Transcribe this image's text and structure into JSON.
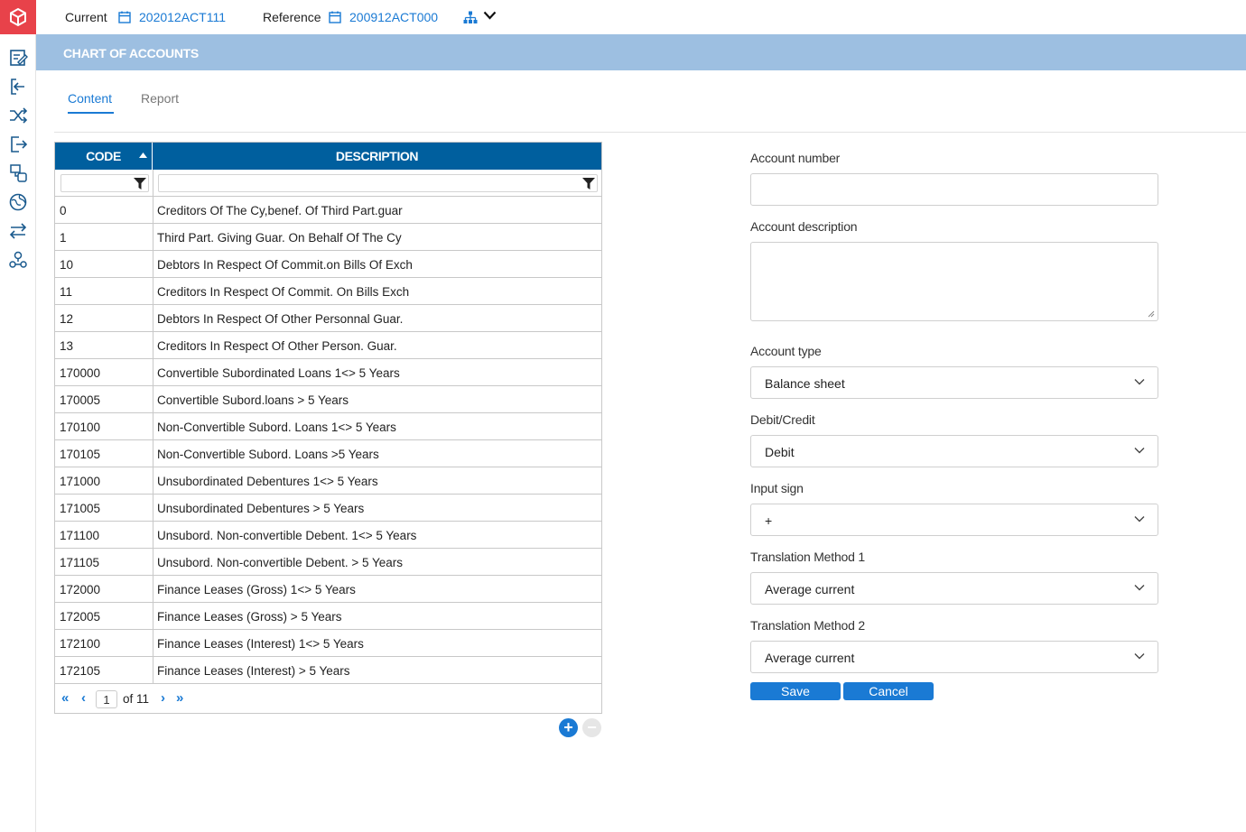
{
  "topbar": {
    "current_label": "Current",
    "current_value": "202012ACT111",
    "reference_label": "Reference",
    "reference_value": "200912ACT000"
  },
  "section": {
    "title": "CHART OF ACCOUNTS"
  },
  "tabs": [
    {
      "label": "Content",
      "active": true
    },
    {
      "label": "Report",
      "active": false
    }
  ],
  "sidebar": {
    "icons": [
      "edit-sheet-icon",
      "import-icon",
      "shuffle-icon",
      "export-icon",
      "copy-database-icon",
      "globe-icon",
      "transfer-icon",
      "network-user-icon"
    ]
  },
  "grid": {
    "columns": [
      "CODE",
      "DESCRIPTION"
    ],
    "rows": [
      {
        "code": "0",
        "description": "Creditors Of The Cy,benef. Of Third Part.guar"
      },
      {
        "code": "1",
        "description": "Third Part. Giving Guar. On Behalf Of The Cy"
      },
      {
        "code": "10",
        "description": "Debtors In Respect Of Commit.on Bills Of Exch"
      },
      {
        "code": "11",
        "description": "Creditors In Respect Of Commit. On Bills Exch"
      },
      {
        "code": "12",
        "description": "Debtors In Respect Of Other Personnal Guar."
      },
      {
        "code": "13",
        "description": "Creditors In Respect Of Other Person. Guar."
      },
      {
        "code": "170000",
        "description": "Convertible Subordinated Loans 1<> 5 Years"
      },
      {
        "code": "170005",
        "description": "Convertible Subord.loans > 5 Years"
      },
      {
        "code": "170100",
        "description": "Non-Convertible Subord. Loans 1<> 5 Years"
      },
      {
        "code": "170105",
        "description": "Non-Convertible Subord. Loans >5 Years"
      },
      {
        "code": "171000",
        "description": "Unsubordinated Debentures 1<> 5 Years"
      },
      {
        "code": "171005",
        "description": "Unsubordinated Debentures > 5 Years"
      },
      {
        "code": "171100",
        "description": "Unsubord. Non-convertible Debent. 1<> 5 Years"
      },
      {
        "code": "171105",
        "description": "Unsubord. Non-convertible Debent. > 5 Years"
      },
      {
        "code": "172000",
        "description": "Finance Leases (Gross) 1<> 5 Years"
      },
      {
        "code": "172005",
        "description": "Finance Leases (Gross) > 5 Years"
      },
      {
        "code": "172100",
        "description": "Finance Leases (Interest) 1<> 5 Years"
      },
      {
        "code": "172105",
        "description": "Finance Leases (Interest) > 5 Years"
      }
    ],
    "pager": {
      "page": "1",
      "of_label": "of 11"
    }
  },
  "form": {
    "account_number_label": "Account number",
    "account_number_value": "",
    "account_description_label": "Account description",
    "account_description_value": "",
    "account_type_label": "Account type",
    "account_type_value": "Balance sheet",
    "debit_credit_label": "Debit/Credit",
    "debit_credit_value": "Debit",
    "input_sign_label": "Input sign",
    "input_sign_value": "+",
    "translation1_label": "Translation Method 1",
    "translation1_value": "Average current",
    "translation2_label": "Translation Method 2",
    "translation2_value": "Average current",
    "save_label": "Save",
    "cancel_label": "Cancel"
  },
  "colors": {
    "accent": "#1a7ad4",
    "grid_header": "#005f9e",
    "section_bar": "#9dbfe1",
    "logo": "#e8424a"
  }
}
